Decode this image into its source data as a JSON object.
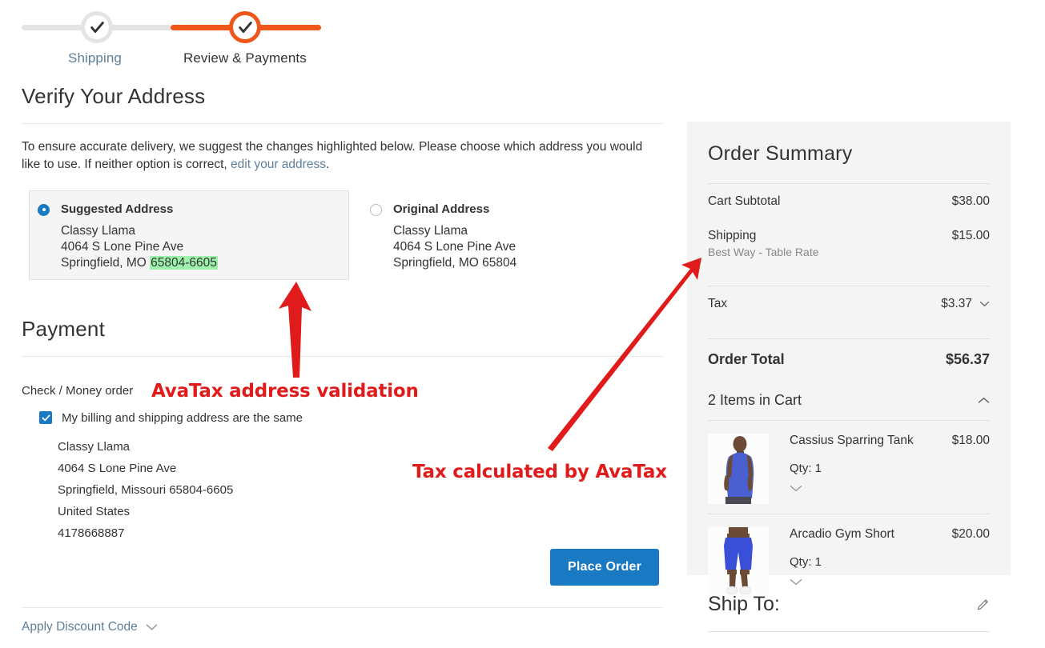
{
  "progress": {
    "steps": [
      {
        "label": "Shipping",
        "state": "done",
        "icon": "check-icon"
      },
      {
        "label": "Review & Payments",
        "state": "active",
        "icon": "check-icon"
      }
    ]
  },
  "verify": {
    "title": "Verify Your Address",
    "intro_before": "To ensure accurate delivery, we suggest the changes highlighted below. Please choose which address you would like to use. If neither option is correct, ",
    "intro_link": "edit your address",
    "intro_after": ".",
    "options": [
      {
        "label": "Suggested Address",
        "selected": true,
        "name": "Classy Llama",
        "street": "4064 S Lone Pine Ave",
        "city_state": "Springfield, MO ",
        "zip": "65804-6605",
        "zip_highlighted": true
      },
      {
        "label": "Original Address",
        "selected": false,
        "name": "Classy Llama",
        "street": "4064 S Lone Pine Ave",
        "city_state": "Springfield, MO 65804",
        "zip": "",
        "zip_highlighted": false
      }
    ]
  },
  "payment": {
    "title": "Payment",
    "method": "Check / Money order",
    "billing_same_checked": true,
    "billing_same_label": "My billing and shipping address are the same",
    "billing_address": [
      "Classy Llama",
      "4064 S Lone Pine Ave",
      "Springfield, Missouri 65804-6605",
      "United States",
      "4178668887"
    ],
    "place_order_label": "Place Order"
  },
  "discount": {
    "label": "Apply Discount Code",
    "icon": "chevron-down-icon"
  },
  "summary": {
    "title": "Order Summary",
    "totals": [
      {
        "label": "Cart Subtotal",
        "value": "$38.00",
        "sub": ""
      },
      {
        "label": "Shipping",
        "value": "$15.00",
        "sub": "Best Way - Table Rate"
      },
      {
        "label": "Tax",
        "value": "$3.37",
        "sub": "",
        "expandable": true
      }
    ],
    "grand_label": "Order Total",
    "grand_value": "$56.37",
    "items_header": "2 Items in Cart",
    "items_header_icon": "chevron-up-icon",
    "items": [
      {
        "name": "Cassius Sparring Tank",
        "price": "$18.00",
        "qty_label": "Qty: 1",
        "thumb": "blue-tank-top-photo"
      },
      {
        "name": "Arcadio Gym Short",
        "price": "$20.00",
        "qty_label": "Qty: 1",
        "thumb": "blue-gym-shorts-photo"
      }
    ]
  },
  "ship_to": {
    "title": "Ship To:",
    "edit_icon": "pencil-icon"
  },
  "annotations": [
    {
      "text": "AvaTax address validation",
      "arrow": "up-arrow"
    },
    {
      "text": "Tax calculated by AvaTax",
      "arrow": "diagonal-up-right-arrow"
    }
  ],
  "colors": {
    "accent_orange": "#f0551a",
    "link_blue": "#5d7f99",
    "button_blue": "#1979c3",
    "highlight_green": "#9cf2ab",
    "annotation_red": "#e01b1b"
  }
}
